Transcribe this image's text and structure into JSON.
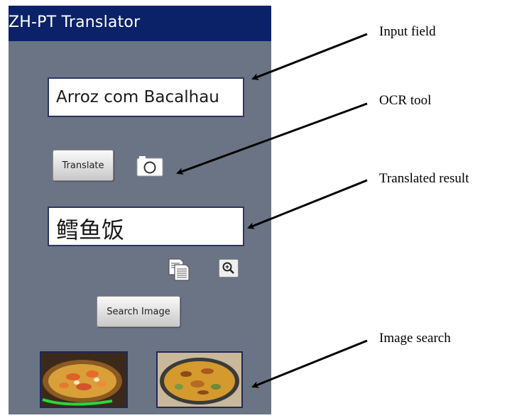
{
  "app": {
    "title": "ZH-PT Translator"
  },
  "input": {
    "value": "Arroz com Bacalhau"
  },
  "buttons": {
    "translate_label": "Translate",
    "search_image_label": "Search Image"
  },
  "result": {
    "text": "鳕鱼饭"
  },
  "icons": {
    "ocr": "camera-icon",
    "copy": "copy-icon",
    "zoom": "zoom-in-icon"
  },
  "annotations": {
    "input_field": "Input field",
    "ocr_tool": "OCR tool",
    "translated_result": "Translated result",
    "image_search": "Image search"
  },
  "colors": {
    "screen_background": "#6b7484",
    "title_bar": "#0b2168",
    "title_text": "#ffffff"
  }
}
